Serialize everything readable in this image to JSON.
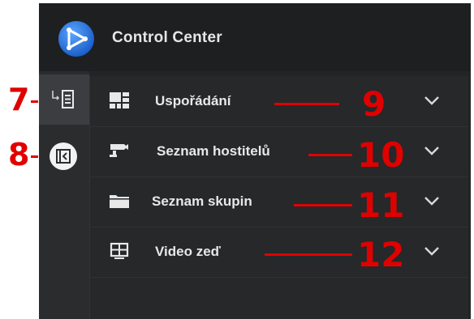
{
  "app": {
    "title": "Control Center",
    "logo_icon": "play-triangle-logo-icon"
  },
  "rail": {
    "items": [
      {
        "icon": "list-view-icon",
        "annotation": "7",
        "active": true
      },
      {
        "icon": "panel-collapse-icon",
        "annotation": "8",
        "active": false
      }
    ]
  },
  "panel": {
    "rows": [
      {
        "label": "Uspořádání",
        "icon": "layout-grid-icon",
        "annotation": "9"
      },
      {
        "label": "Seznam hostitelů",
        "icon": "camera-icon",
        "annotation": "10"
      },
      {
        "label": "Seznam skupin",
        "icon": "folder-icon",
        "annotation": "11"
      },
      {
        "label": "Video zeď",
        "icon": "video-wall-icon",
        "annotation": "12"
      }
    ]
  },
  "colors": {
    "background": "#222426",
    "header": "#1d1f21",
    "accent_logo": "#2f7fe0",
    "annotation": "#e00000",
    "text": "#e8e8e8"
  }
}
